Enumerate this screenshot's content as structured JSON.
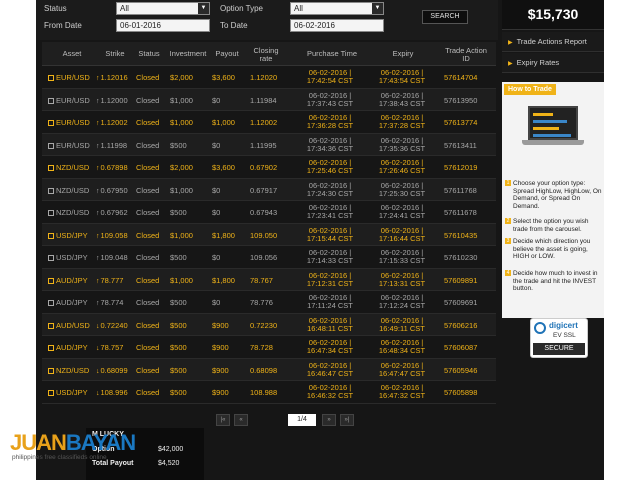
{
  "filters": {
    "status_label": "Status",
    "status_value": "All",
    "option_type_label": "Option Type",
    "option_type_value": "All",
    "from_label": "From Date",
    "from_value": "06-01-2016",
    "to_label": "To Date",
    "to_value": "06-02-2016",
    "search_label": "SEARCH"
  },
  "columns": {
    "asset": "Asset",
    "strike": "Strike",
    "status": "Status",
    "investment": "Investment",
    "payout": "Payout",
    "closing1": "Closing",
    "closing2": "rate",
    "purchase": "Purchase Time",
    "expiry": "Expiry",
    "trade1": "Trade Action",
    "trade2": "ID"
  },
  "rows": [
    {
      "asset": "EUR/USD",
      "dir": "↑",
      "strike": "1.12016",
      "status": "Closed",
      "investment": "$2,000",
      "payout": "$3,600",
      "closing": "1.12020",
      "p1": "06-02-2016 |",
      "p2": "17:42:54 CST",
      "e1": "06-02-2016 |",
      "e2": "17:43:54 CST",
      "id": "57614704",
      "win": true
    },
    {
      "asset": "EUR/USD",
      "dir": "↑",
      "strike": "1.12000",
      "status": "Closed",
      "investment": "$1,000",
      "payout": "$0",
      "closing": "1.11984",
      "p1": "06-02-2016 |",
      "p2": "17:37:43 CST",
      "e1": "06-02-2016 |",
      "e2": "17:38:43 CST",
      "id": "57613950",
      "win": false
    },
    {
      "asset": "EUR/USD",
      "dir": "↑",
      "strike": "1.12002",
      "status": "Closed",
      "investment": "$1,000",
      "payout": "$1,000",
      "closing": "1.12002",
      "p1": "06-02-2016 |",
      "p2": "17:36:28 CST",
      "e1": "06-02-2016 |",
      "e2": "17:37:28 CST",
      "id": "57613774",
      "win": true
    },
    {
      "asset": "EUR/USD",
      "dir": "↑",
      "strike": "1.11998",
      "status": "Closed",
      "investment": "$500",
      "payout": "$0",
      "closing": "1.11995",
      "p1": "06-02-2016 |",
      "p2": "17:34:36 CST",
      "e1": "06-02-2016 |",
      "e2": "17:35:36 CST",
      "id": "57613411",
      "win": false
    },
    {
      "asset": "NZD/USD",
      "dir": "↑",
      "strike": "0.67898",
      "status": "Closed",
      "investment": "$2,000",
      "payout": "$3,600",
      "closing": "0.67902",
      "p1": "06-02-2016 |",
      "p2": "17:25:46 CST",
      "e1": "06-02-2016 |",
      "e2": "17:26:46 CST",
      "id": "57612019",
      "win": true
    },
    {
      "asset": "NZD/USD",
      "dir": "↑",
      "strike": "0.67950",
      "status": "Closed",
      "investment": "$1,000",
      "payout": "$0",
      "closing": "0.67917",
      "p1": "06-02-2016 |",
      "p2": "17:24:30 CST",
      "e1": "06-02-2016 |",
      "e2": "17:25:30 CST",
      "id": "57611768",
      "win": false
    },
    {
      "asset": "NZD/USD",
      "dir": "↑",
      "strike": "0.67962",
      "status": "Closed",
      "investment": "$500",
      "payout": "$0",
      "closing": "0.67943",
      "p1": "06-02-2016 |",
      "p2": "17:23:41 CST",
      "e1": "06-02-2016 |",
      "e2": "17:24:41 CST",
      "id": "57611678",
      "win": false
    },
    {
      "asset": "USD/JPY",
      "dir": "↑",
      "strike": "109.058",
      "status": "Closed",
      "investment": "$1,000",
      "payout": "$1,800",
      "closing": "109.050",
      "p1": "06-02-2016 |",
      "p2": "17:15:44 CST",
      "e1": "06-02-2016 |",
      "e2": "17:16:44 CST",
      "id": "57610435",
      "win": true
    },
    {
      "asset": "USD/JPY",
      "dir": "↑",
      "strike": "109.048",
      "status": "Closed",
      "investment": "$500",
      "payout": "$0",
      "closing": "109.056",
      "p1": "06-02-2016 |",
      "p2": "17:14:33 CST",
      "e1": "06-02-2016 |",
      "e2": "17:15:33 CST",
      "id": "57610230",
      "win": false
    },
    {
      "asset": "AUD/JPY",
      "dir": "↑",
      "strike": "78.777",
      "status": "Closed",
      "investment": "$1,000",
      "payout": "$1,800",
      "closing": "78.767",
      "p1": "06-02-2016 |",
      "p2": "17:12:31 CST",
      "e1": "06-02-2016 |",
      "e2": "17:13:31 CST",
      "id": "57609891",
      "win": true
    },
    {
      "asset": "AUD/JPY",
      "dir": "↑",
      "strike": "78.774",
      "status": "Closed",
      "investment": "$500",
      "payout": "$0",
      "closing": "78.776",
      "p1": "06-02-2016 |",
      "p2": "17:11:24 CST",
      "e1": "06-02-2016 |",
      "e2": "17:12:24 CST",
      "id": "57609691",
      "win": false
    },
    {
      "asset": "AUD/USD",
      "dir": "↓",
      "strike": "0.72240",
      "status": "Closed",
      "investment": "$500",
      "payout": "$900",
      "closing": "0.72230",
      "p1": "06-02-2016 |",
      "p2": "16:48:11 CST",
      "e1": "06-02-2016 |",
      "e2": "16:49:11 CST",
      "id": "57606216",
      "win": true
    },
    {
      "asset": "AUD/JPY",
      "dir": "↓",
      "strike": "78.757",
      "status": "Closed",
      "investment": "$500",
      "payout": "$900",
      "closing": "78.728",
      "p1": "06-02-2016 |",
      "p2": "16:47:34 CST",
      "e1": "06-02-2016 |",
      "e2": "16:48:34 CST",
      "id": "57606087",
      "win": true
    },
    {
      "asset": "NZD/USD",
      "dir": "↓",
      "strike": "0.68099",
      "status": "Closed",
      "investment": "$500",
      "payout": "$900",
      "closing": "0.68098",
      "p1": "06-02-2016 |",
      "p2": "16:46:47 CST",
      "e1": "06-02-2016 |",
      "e2": "16:47:47 CST",
      "id": "57605946",
      "win": true
    },
    {
      "asset": "USD/JPY",
      "dir": "↓",
      "strike": "108.996",
      "status": "Closed",
      "investment": "$500",
      "payout": "$900",
      "closing": "108.988",
      "p1": "06-02-2016 |",
      "p2": "16:46:32 CST",
      "e1": "06-02-2016 |",
      "e2": "16:47:32 CST",
      "id": "57605898",
      "win": true
    }
  ],
  "pager": {
    "first": "|«",
    "prev": "«",
    "page": "1/4",
    "next": "»",
    "last": "»|"
  },
  "sidebar": {
    "balance": "$15,730",
    "nav_items": [
      "Trade Actions Report",
      "Expiry Rates"
    ],
    "howto_title": "How to Trade",
    "steps": [
      "Choose your option type: Spread HighLow, HighLow, On Demand, or Spread On Demand.",
      "Select the option you wish trade from the carousel.",
      "Decide which direction you believe the asset is going, HIGH or LOW.",
      "Decide how much to invest in the trade and hit the INVEST button."
    ],
    "digicert_name": "digicert",
    "digicert_ev": "EV SSL",
    "digicert_secure": "SECURE"
  },
  "popup": {
    "l1": "M LUCKY",
    "l2": "Option",
    "v2": "$42,000",
    "l3": "Total Payout",
    "v3": "$4,520"
  },
  "watermark": {
    "brand_a": "JUAN",
    "brand_b": "BAYAN",
    "tagline": "philippines free classifieds online"
  },
  "colors": {
    "win": "#f0b318",
    "lose": "#a8a8a8",
    "background": "#161616",
    "accent": "#f0b318"
  }
}
